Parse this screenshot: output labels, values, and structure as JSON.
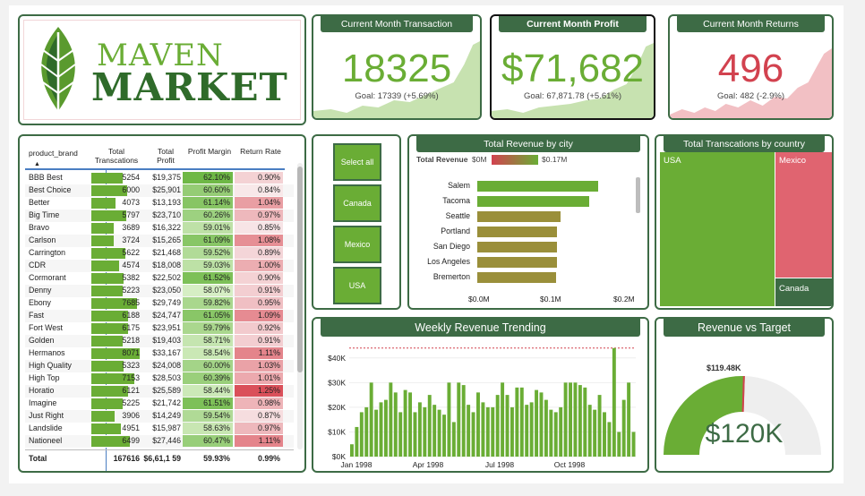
{
  "brand": {
    "logo_line1": "MAVEN",
    "logo_line2": "MARKET"
  },
  "kpis": [
    {
      "title": "Current Month Transaction",
      "value": "18325",
      "goal": "Goal: 17339 (+5.69%)",
      "color": "#6aad35",
      "fill": "#c7e2b0"
    },
    {
      "title": "Current Month Profit",
      "value": "$71,682",
      "goal": "Goal: 67,871.78 (+5.61%)",
      "color": "#6aad35",
      "fill": "#c7e2b0"
    },
    {
      "title": "Current Month Returns",
      "value": "496",
      "goal": "Goal: 482 (-2.9%)",
      "color": "#d2424f",
      "fill": "#f2c0c4"
    }
  ],
  "table": {
    "headers": {
      "brand": "product_brand",
      "trans": "Total Transcations",
      "profit": "Total Profit",
      "margin": "Profit Margin",
      "ret": "Return Rate"
    },
    "rows": [
      {
        "brand": "BBB Best",
        "trans": 5254,
        "profit": "$19,375",
        "margin": "62.10%",
        "ret": "0.90%"
      },
      {
        "brand": "Best Choice",
        "trans": 6000,
        "profit": "$25,901",
        "margin": "60.60%",
        "ret": "0.84%"
      },
      {
        "brand": "Better",
        "trans": 4073,
        "profit": "$13,193",
        "margin": "61.14%",
        "ret": "1.04%"
      },
      {
        "brand": "Big Time",
        "trans": 5797,
        "profit": "$23,710",
        "margin": "60.26%",
        "ret": "0.97%"
      },
      {
        "brand": "Bravo",
        "trans": 3689,
        "profit": "$16,322",
        "margin": "59.01%",
        "ret": "0.85%"
      },
      {
        "brand": "Carlson",
        "trans": 3724,
        "profit": "$15,265",
        "margin": "61.09%",
        "ret": "1.08%"
      },
      {
        "brand": "Carrington",
        "trans": 5622,
        "profit": "$21,468",
        "margin": "59.52%",
        "ret": "0.89%"
      },
      {
        "brand": "CDR",
        "trans": 4574,
        "profit": "$18,008",
        "margin": "59.03%",
        "ret": "1.00%"
      },
      {
        "brand": "Cormorant",
        "trans": 5382,
        "profit": "$22,502",
        "margin": "61.52%",
        "ret": "0.90%"
      },
      {
        "brand": "Denny",
        "trans": 5223,
        "profit": "$23,050",
        "margin": "58.07%",
        "ret": "0.91%"
      },
      {
        "brand": "Ebony",
        "trans": 7685,
        "profit": "$29,749",
        "margin": "59.82%",
        "ret": "0.95%"
      },
      {
        "brand": "Fast",
        "trans": 6188,
        "profit": "$24,747",
        "margin": "61.05%",
        "ret": "1.09%"
      },
      {
        "brand": "Fort West",
        "trans": 6175,
        "profit": "$23,951",
        "margin": "59.79%",
        "ret": "0.92%"
      },
      {
        "brand": "Golden",
        "trans": 5218,
        "profit": "$19,403",
        "margin": "58.71%",
        "ret": "0.91%"
      },
      {
        "brand": "Hermanos",
        "trans": 8071,
        "profit": "$33,167",
        "margin": "58.54%",
        "ret": "1.11%"
      },
      {
        "brand": "High Quality",
        "trans": 5323,
        "profit": "$24,008",
        "margin": "60.00%",
        "ret": "1.03%"
      },
      {
        "brand": "High Top",
        "trans": 7153,
        "profit": "$28,503",
        "margin": "60.39%",
        "ret": "1.01%"
      },
      {
        "brand": "Horatio",
        "trans": 6121,
        "profit": "$25,589",
        "margin": "58.44%",
        "ret": "1.25%"
      },
      {
        "brand": "Imagine",
        "trans": 5225,
        "profit": "$21,742",
        "margin": "61.51%",
        "ret": "0.98%"
      },
      {
        "brand": "Just Right",
        "trans": 3906,
        "profit": "$14,249",
        "margin": "59.54%",
        "ret": "0.87%"
      },
      {
        "brand": "Landslide",
        "trans": 4951,
        "profit": "$15,987",
        "margin": "58.63%",
        "ret": "0.97%"
      },
      {
        "brand": "Nationeel",
        "trans": 6499,
        "profit": "$27,446",
        "margin": "60.47%",
        "ret": "1.11%"
      }
    ],
    "total": {
      "label": "Total",
      "trans": "167616",
      "profit": "$6,61,1 59",
      "margin": "59.93%",
      "ret": "0.99%"
    }
  },
  "slicer": {
    "options": [
      "Select all",
      "Canada",
      "Mexico",
      "USA"
    ]
  },
  "city_chart": {
    "title": "Total Revenue by city",
    "legend_label": "Total Revenue",
    "legend_min": "$0M",
    "legend_max": "$0.17M",
    "ticks": [
      "$0.0M",
      "$0.1M",
      "$0.2M"
    ]
  },
  "country_treemap": {
    "title": "Total Transcations by country",
    "labels": [
      "USA",
      "Mexico",
      "Canada"
    ]
  },
  "weekly_chart": {
    "title": "Weekly Revenue Trending"
  },
  "gauge": {
    "title": "Revenue vs Target",
    "target_label": "$119.48K",
    "value_label": "$120K"
  },
  "chart_data": [
    {
      "type": "bar",
      "title": "Total Revenue by city",
      "categories": [
        "Salem",
        "Tacoma",
        "Seattle",
        "Portland",
        "San Diego",
        "Los Angeles",
        "Bremerton"
      ],
      "values": [
        0.165,
        0.153,
        0.113,
        0.109,
        0.108,
        0.108,
        0.107
      ],
      "xlim": [
        0,
        0.2
      ],
      "tick_labels": [
        "$0.0M",
        "$0.1M",
        "$0.2M"
      ],
      "colors": {
        "high": "#6aad35",
        "low": "#9a8f3a"
      }
    },
    {
      "type": "bar",
      "title": "Weekly Revenue Trending",
      "yticks": [
        "$0K",
        "$10K",
        "$20K",
        "$30K",
        "$40K"
      ],
      "ylim": [
        0,
        45
      ],
      "xticks": [
        "Jan 1998",
        "Apr 1998",
        "Jul 1998",
        "Oct 1998"
      ],
      "reference_line": 44,
      "values": [
        5,
        12,
        18,
        20,
        30,
        19,
        22,
        23,
        30,
        26,
        18,
        27,
        26,
        18,
        22,
        20,
        25,
        21,
        19,
        17,
        30,
        14,
        30,
        29,
        21,
        18,
        26,
        22,
        20,
        20,
        25,
        30,
        25,
        20,
        28,
        28,
        21,
        22,
        27,
        26,
        23,
        19,
        18,
        20,
        30,
        30,
        30,
        29,
        28,
        21,
        19,
        25,
        18,
        14,
        44,
        10,
        23,
        30,
        10
      ],
      "color": "#6aad35"
    },
    {
      "type": "treemap",
      "title": "Total Transcations by country",
      "categories": [
        "USA",
        "Mexico",
        "Canada"
      ],
      "values": [
        0.67,
        0.28,
        0.05
      ],
      "colors": [
        "#6aad35",
        "#e06470",
        "#3d6b45"
      ]
    },
    {
      "type": "gauge",
      "title": "Revenue vs Target",
      "value": 120,
      "target": 119.48,
      "max": 165,
      "color": "#6aad35"
    }
  ]
}
